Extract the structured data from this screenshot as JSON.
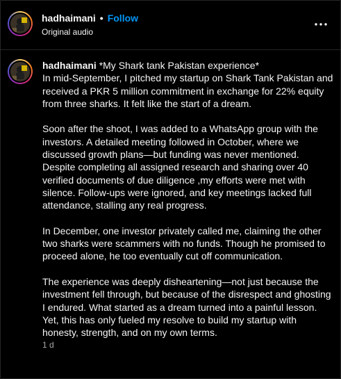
{
  "header": {
    "username": "hadhaimani",
    "separator": "•",
    "follow_label": "Follow",
    "subtitle": "Original audio",
    "more_icon": "more-horizontal-icon"
  },
  "caption": {
    "username": "hadhaimani",
    "paragraphs": [
      "*My Shark tank Pakistan experience*\nIn mid-September, I pitched my startup on Shark Tank Pakistan and received a PKR 5 million commitment in exchange for 22% equity from three sharks. It felt like the start of a dream.",
      "Soon after the shoot, I was added to a WhatsApp group with the investors. A detailed meeting followed in October, where we discussed growth plans—but funding was never mentioned. Despite completing all assigned research and sharing over 40 verified documents of due diligence ,my efforts were met with silence. Follow-ups were ignored, and key meetings lacked full attendance, stalling any real progress.",
      "In December, one investor privately called me, claiming the other two sharks were scammers with no funds. Though he promised to proceed alone, he too eventually cut off communication.",
      "The experience was deeply disheartening—not just because the investment fell through, but because of the disrespect and ghosting I endured. What started as a dream turned into a painful lesson. Yet, this has only fueled my resolve to build my startup with honesty, strength, and on my own terms."
    ],
    "timestamp": "1 d"
  },
  "colors": {
    "background": "#000000",
    "text": "#f5f5f5",
    "follow": "#0095f6",
    "muted": "#a8a8a8",
    "divider": "#262626"
  }
}
